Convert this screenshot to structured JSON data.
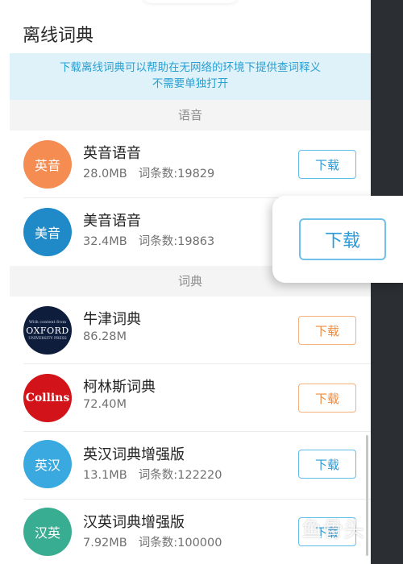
{
  "page": {
    "title": "离线词典",
    "notice": "下载离线词典可以帮助在无网络的环境下提供查词释义\n不需要单独打开"
  },
  "sections": {
    "voice": "语音",
    "dict": "词典"
  },
  "items": [
    {
      "avatar": "英音",
      "avatar_color": "#f58c52",
      "name": "英音语音",
      "size": "28.0MB",
      "entries": "词条数:19829",
      "button": "下载",
      "button_style": "blue"
    },
    {
      "avatar": "美音",
      "avatar_color": "#1f8ac7",
      "name": "美音语音",
      "size": "32.4MB",
      "entries": "词条数:19863",
      "button": "下载",
      "button_style": "blue"
    },
    {
      "avatar": "OXFORD",
      "avatar_small_top": "With content from",
      "avatar_small_bottom": "UNIVERSITY PRESS",
      "avatar_color": "#0f1d3d",
      "name": "牛津词典",
      "size": "86.28M",
      "entries": "",
      "button": "下载",
      "button_style": "orange"
    },
    {
      "avatar": "Collins",
      "avatar_color": "#d2131a",
      "name": "柯林斯词典",
      "size": "72.40M",
      "entries": "",
      "button": "下载",
      "button_style": "orange"
    },
    {
      "avatar": "英汉",
      "avatar_color": "#3aa9e0",
      "name": "英汉词典增强版",
      "size": "13.1MB",
      "entries": "词条数:122220",
      "button": "下载",
      "button_style": "blue"
    },
    {
      "avatar": "汉英",
      "avatar_color": "#39ad92",
      "name": "汉英词典增强版",
      "size": "7.92MB",
      "entries": "词条数:100000",
      "button": "下载",
      "button_style": "blue"
    }
  ],
  "callout": {
    "label": "下载"
  },
  "watermark": {
    "text": "鱼骨头"
  },
  "colors": {
    "accent_blue": "#2a9bd8",
    "accent_orange": "#f08a3c",
    "notice_bg": "#dff2fa"
  }
}
